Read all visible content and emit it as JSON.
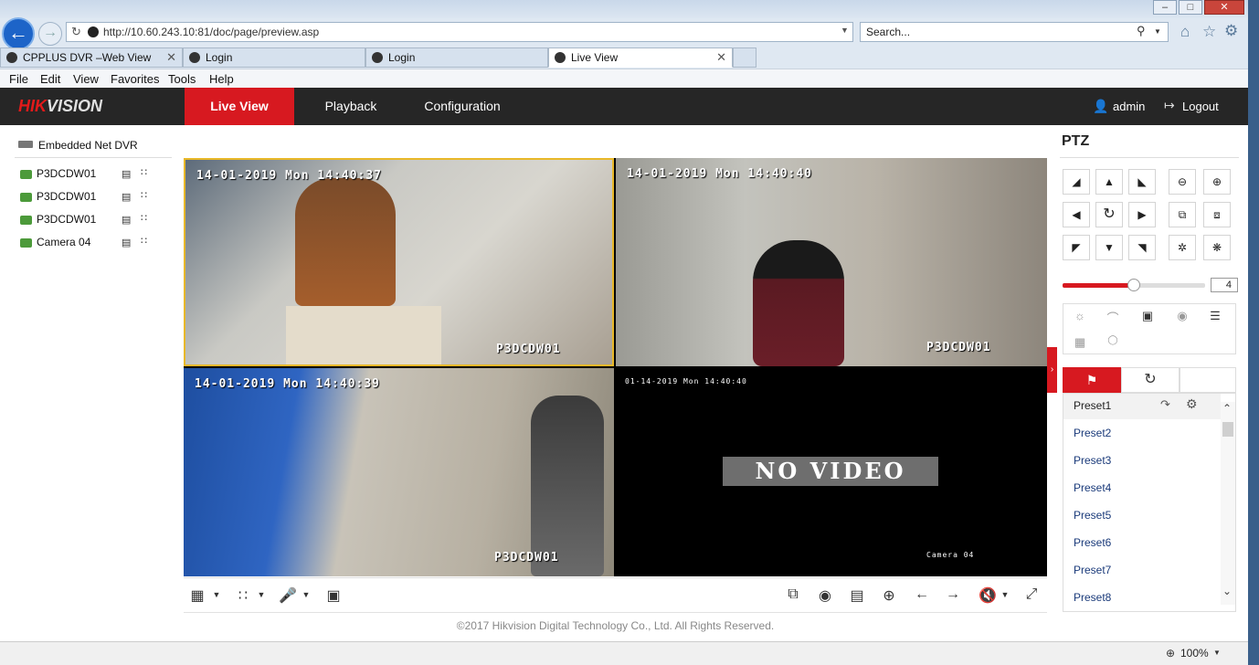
{
  "browser": {
    "url": "http://10.60.243.10:81/doc/page/preview.asp",
    "search_placeholder": "Search...",
    "tabs": [
      {
        "label": "CPPLUS DVR –Web View"
      },
      {
        "label": "Login"
      },
      {
        "label": "Login"
      },
      {
        "label": "Live View"
      }
    ],
    "menu": [
      "File",
      "Edit",
      "View",
      "Favorites",
      "Tools",
      "Help"
    ],
    "zoom": "100%"
  },
  "header": {
    "logo_hik": "HIK",
    "logo_vision": "VISION",
    "nav": [
      {
        "label": "Live View"
      },
      {
        "label": "Playback"
      },
      {
        "label": "Configuration"
      }
    ],
    "user": "admin",
    "logout": "Logout"
  },
  "tree": {
    "root": "Embedded Net DVR",
    "cameras": [
      {
        "label": "P3DCDW01"
      },
      {
        "label": "P3DCDW01"
      },
      {
        "label": "P3DCDW01"
      },
      {
        "label": "Camera 04"
      }
    ]
  },
  "video": {
    "panes": [
      {
        "timestamp": "14-01-2019 Mon 14:40:37",
        "name": "P3DCDW01"
      },
      {
        "timestamp": "14-01-2019 Mon 14:40:40",
        "name": "P3DCDW01"
      },
      {
        "timestamp": "14-01-2019 Mon 14:40:39",
        "name": "P3DCDW01"
      },
      {
        "timestamp": "01-14-2019 Mon 14:40:40",
        "name": "Camera 04",
        "no_video": "NO VIDEO"
      }
    ]
  },
  "footer": "©2017 Hikvision Digital Technology Co., Ltd. All Rights Reserved.",
  "ptz": {
    "title": "PTZ",
    "speed": "4",
    "speed_level": 0.5,
    "presets": [
      "Preset1",
      "Preset2",
      "Preset3",
      "Preset4",
      "Preset5",
      "Preset6",
      "Preset7",
      "Preset8"
    ]
  },
  "colors": {
    "accent": "#d71920",
    "header_bg": "#262626"
  }
}
